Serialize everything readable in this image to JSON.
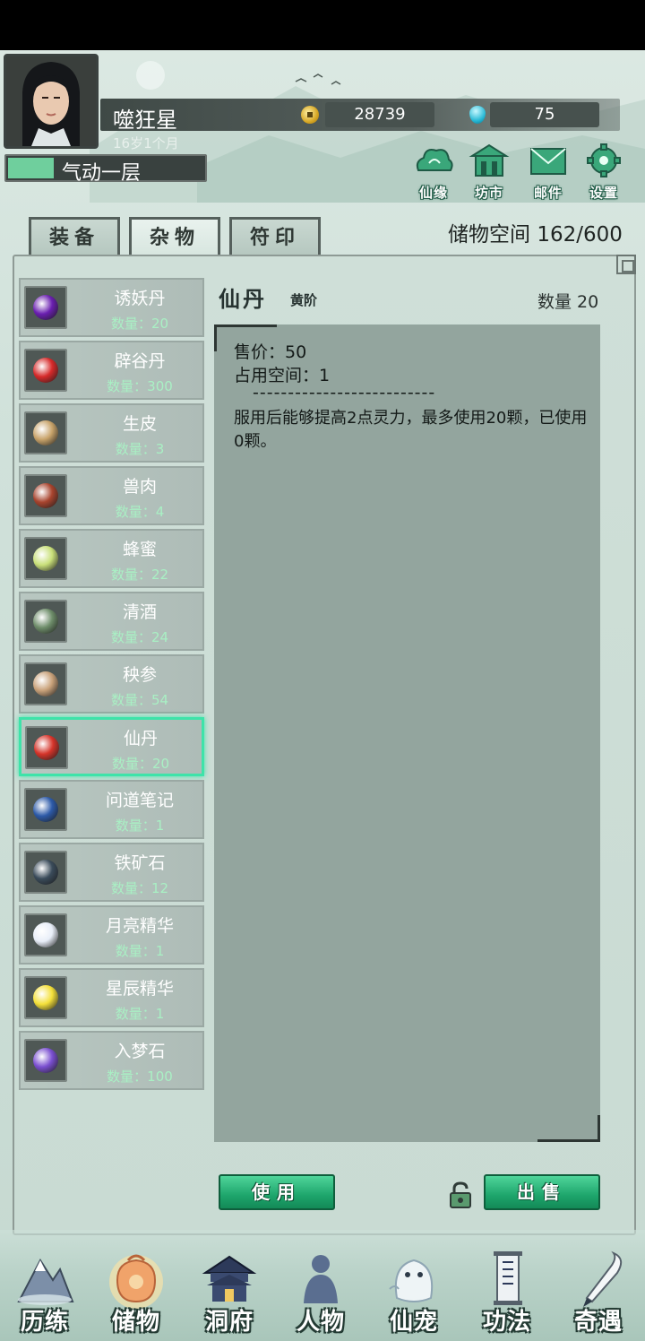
{
  "player": {
    "name": "噬狂星",
    "age": "16岁1个月",
    "coins": "28739",
    "gems": "75",
    "realm": "气动一层",
    "realm_progress": 0.23
  },
  "top_buttons": [
    {
      "label": "仙缘",
      "icon": "cloud-icon"
    },
    {
      "label": "坊市",
      "icon": "market-icon"
    },
    {
      "label": "邮件",
      "icon": "mail-icon"
    },
    {
      "label": "设置",
      "icon": "gear-icon"
    }
  ],
  "tabs": [
    {
      "label": "装备",
      "active": false
    },
    {
      "label": "杂物",
      "active": true
    },
    {
      "label": "符印",
      "active": false
    }
  ],
  "storage": {
    "label": "储物空间",
    "value": "162/600"
  },
  "items": [
    {
      "name": "诱妖丹",
      "qty": "数量：20",
      "icon": "purple-orb-icon",
      "color": "#6a1fb0",
      "selected": false
    },
    {
      "name": "辟谷丹",
      "qty": "数量：300",
      "icon": "red-pill-icon",
      "color": "#d62a2a",
      "selected": false
    },
    {
      "name": "生皮",
      "qty": "数量：3",
      "icon": "hide-icon",
      "color": "#c8a36a",
      "selected": false
    },
    {
      "name": "兽肉",
      "qty": "数量：4",
      "icon": "meat-icon",
      "color": "#a8442e",
      "selected": false
    },
    {
      "name": "蜂蜜",
      "qty": "数量：22",
      "icon": "honey-bottle-icon",
      "color": "#c9e07a",
      "selected": false
    },
    {
      "name": "清酒",
      "qty": "数量：24",
      "icon": "wine-pot-icon",
      "color": "#6e8d6a",
      "selected": false
    },
    {
      "name": "秧参",
      "qty": "数量：54",
      "icon": "ginseng-icon",
      "color": "#c9a27a",
      "selected": false
    },
    {
      "name": "仙丹",
      "qty": "数量：20",
      "icon": "elixir-icon",
      "color": "#d5342a",
      "selected": true
    },
    {
      "name": "问道笔记",
      "qty": "数量：1",
      "icon": "book-icon",
      "color": "#2d5aa8",
      "selected": false
    },
    {
      "name": "铁矿石",
      "qty": "数量：12",
      "icon": "iron-ore-icon",
      "color": "#3a4b5a",
      "selected": false
    },
    {
      "name": "月亮精华",
      "qty": "数量：1",
      "icon": "moon-icon",
      "color": "#e8eef8",
      "selected": false
    },
    {
      "name": "星辰精华",
      "qty": "数量：1",
      "icon": "star-icon",
      "color": "#f4e03a",
      "selected": false
    },
    {
      "name": "入梦石",
      "qty": "数量：100",
      "icon": "dream-stone-icon",
      "color": "#7a4fd0",
      "selected": false
    }
  ],
  "detail": {
    "title": "仙丹",
    "grade": "黄阶",
    "qty": "数量 20",
    "price": "售价：50",
    "space": "占用空间：1",
    "divider": "--------------------------",
    "description": "服用后能够提高2点灵力，最多使用20颗，已使用0颗。"
  },
  "actions": {
    "use": "使用",
    "sell": "出售"
  },
  "bottom_nav": [
    {
      "label": "历练",
      "icon": "mountain-icon"
    },
    {
      "label": "储物",
      "icon": "bag-icon"
    },
    {
      "label": "洞府",
      "icon": "palace-icon"
    },
    {
      "label": "人物",
      "icon": "person-icon"
    },
    {
      "label": "仙宠",
      "icon": "pet-icon"
    },
    {
      "label": "功法",
      "icon": "scroll-icon"
    },
    {
      "label": "奇遇",
      "icon": "brush-icon"
    }
  ],
  "colors": {
    "accent": "#3ee3a9",
    "button_green": "#1ea56c",
    "qty_green": "#a9f0c4"
  }
}
